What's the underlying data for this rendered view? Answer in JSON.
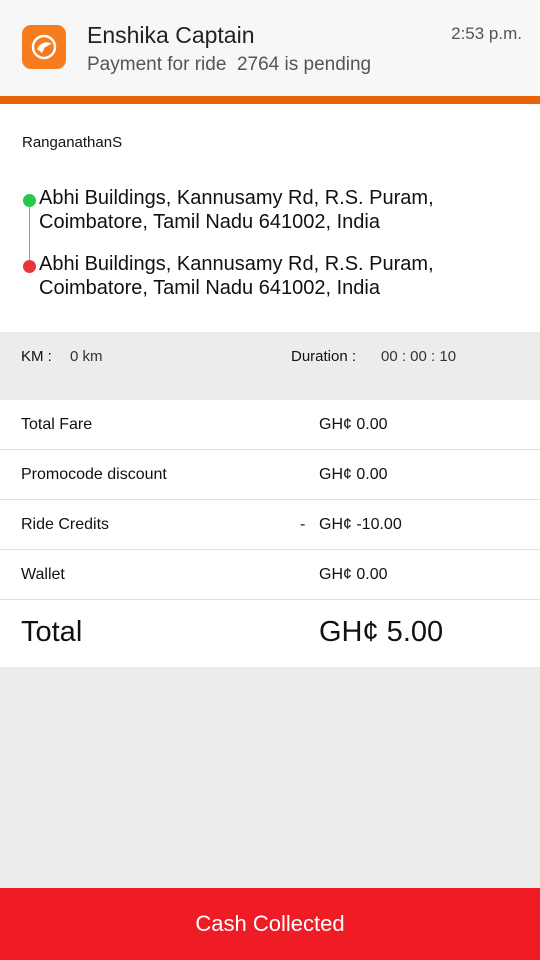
{
  "notification": {
    "app_icon": "enshika-logo-icon",
    "title": "Enshika Captain",
    "body": "Payment for ride  2764 is pending",
    "time": "2:53 p.m."
  },
  "trip": {
    "rider_name": "RanganathanS",
    "pickup": "Abhi Buildings, Kannusamy Rd, R.S. Puram, Coimbatore, Tamil Nadu 641002, India",
    "drop": "Abhi Buildings, Kannusamy Rd, R.S. Puram, Coimbatore, Tamil Nadu 641002, India"
  },
  "stats": {
    "km_label": "KM :",
    "km_value": "0 km",
    "duration_label": "Duration :",
    "duration_value": "00 : 00 : 10"
  },
  "fare": {
    "rows": [
      {
        "label": "Total Fare",
        "sign": "",
        "value": "GH¢ 0.00"
      },
      {
        "label": "Promocode discount",
        "sign": "",
        "value": "GH¢ 0.00"
      },
      {
        "label": "Ride Credits",
        "sign": "-",
        "value": "GH¢ -10.00"
      },
      {
        "label": "Wallet",
        "sign": "",
        "value": "GH¢ 0.00"
      }
    ],
    "total_label": "Total",
    "total_value": "GH¢ 5.00"
  },
  "action": {
    "cash_collected_label": "Cash Collected"
  },
  "colors": {
    "accent_orange": "#e8630a",
    "button_red": "#ef1c25",
    "pickup_dot": "#27c94a",
    "drop_dot": "#e8343a"
  }
}
